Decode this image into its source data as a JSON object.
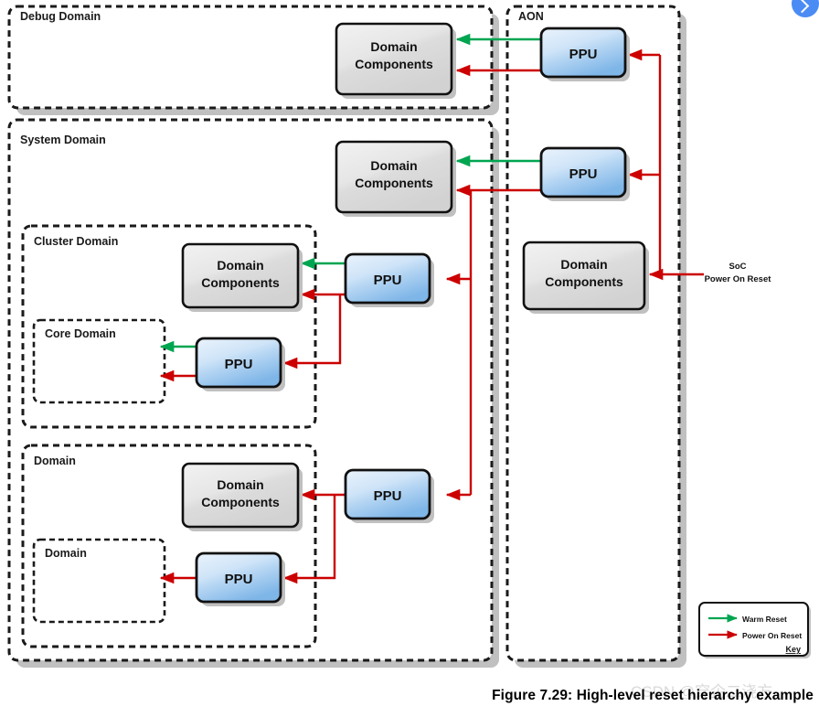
{
  "figure": {
    "caption": "Figure 7.29: High-level reset hierarchy example",
    "watermark": "CSDN @穿企二浇方"
  },
  "colors": {
    "warm_reset": "#00a550",
    "power_on_reset": "#cc0000",
    "ppu_fill_top": "#dceaf9",
    "ppu_fill_bottom": "#7fb6e8",
    "component_fill": "#e8e8e8",
    "domain_border": "#1a1a1a",
    "shadow": "#c0c0c0",
    "accent": "#4b8bf4"
  },
  "domains": {
    "debug": {
      "label": "Debug Domain"
    },
    "system": {
      "label": "System Domain"
    },
    "cluster": {
      "label": "Cluster Domain"
    },
    "core": {
      "label": "Core Domain"
    },
    "mid": {
      "label": "Domain"
    },
    "leaf": {
      "label": "Domain"
    },
    "aon": {
      "label": "AON"
    }
  },
  "blocks": {
    "debug_components": {
      "line1": "Domain",
      "line2": "Components"
    },
    "system_components": {
      "line1": "Domain",
      "line2": "Components"
    },
    "cluster_components": {
      "line1": "Domain",
      "line2": "Components"
    },
    "mid_components": {
      "line1": "Domain",
      "line2": "Components"
    },
    "aon_components": {
      "line1": "Domain",
      "line2": "Components"
    },
    "ppu_aon_debug": {
      "label": "PPU"
    },
    "ppu_aon_system": {
      "label": "PPU"
    },
    "ppu_cluster": {
      "label": "PPU"
    },
    "ppu_core": {
      "label": "PPU"
    },
    "ppu_mid": {
      "label": "PPU"
    },
    "ppu_leaf": {
      "label": "PPU"
    }
  },
  "signals": {
    "soc_reset_line1": "SoC",
    "soc_reset_line2": "Power On Reset"
  },
  "legend": {
    "title": "Key",
    "items": [
      {
        "label": "Warm Reset",
        "color": "#00a550"
      },
      {
        "label": "Power On Reset",
        "color": "#cc0000"
      }
    ]
  }
}
